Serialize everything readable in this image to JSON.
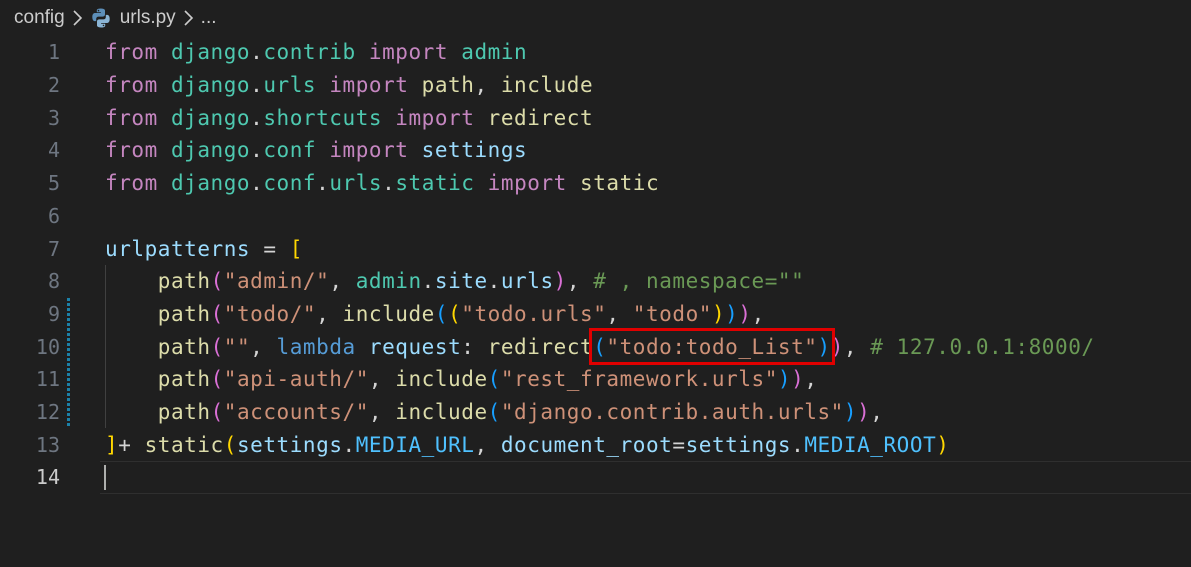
{
  "breadcrumb": {
    "folder": "config",
    "file": "urls.py",
    "more": "..."
  },
  "editor": {
    "current_line": 14,
    "lines": [
      {
        "n": "1",
        "t": [
          [
            "from ",
            "kw"
          ],
          [
            "django",
            "mod"
          ],
          [
            ".",
            "pl"
          ],
          [
            "contrib",
            "mod"
          ],
          [
            " import ",
            "kw"
          ],
          [
            "admin",
            "mod"
          ]
        ]
      },
      {
        "n": "2",
        "t": [
          [
            "from ",
            "kw"
          ],
          [
            "django",
            "mod"
          ],
          [
            ".",
            "pl"
          ],
          [
            "urls",
            "mod"
          ],
          [
            " import ",
            "kw"
          ],
          [
            "path",
            "fn"
          ],
          [
            ", ",
            "pl"
          ],
          [
            "include",
            "fn"
          ]
        ]
      },
      {
        "n": "3",
        "t": [
          [
            "from ",
            "kw"
          ],
          [
            "django",
            "mod"
          ],
          [
            ".",
            "pl"
          ],
          [
            "shortcuts",
            "mod"
          ],
          [
            " import ",
            "kw"
          ],
          [
            "redirect",
            "fn"
          ]
        ]
      },
      {
        "n": "4",
        "t": [
          [
            "from ",
            "kw"
          ],
          [
            "django",
            "mod"
          ],
          [
            ".",
            "pl"
          ],
          [
            "conf",
            "mod"
          ],
          [
            " import ",
            "kw"
          ],
          [
            "settings",
            "var"
          ]
        ]
      },
      {
        "n": "5",
        "t": [
          [
            "from ",
            "kw"
          ],
          [
            "django",
            "mod"
          ],
          [
            ".",
            "pl"
          ],
          [
            "conf",
            "mod"
          ],
          [
            ".",
            "pl"
          ],
          [
            "urls",
            "mod"
          ],
          [
            ".",
            "pl"
          ],
          [
            "static",
            "mod"
          ],
          [
            " import ",
            "kw"
          ],
          [
            "static",
            "fn"
          ]
        ]
      },
      {
        "n": "6",
        "t": []
      },
      {
        "n": "7",
        "t": [
          [
            "urlpatterns",
            "var"
          ],
          [
            " = ",
            "pl"
          ],
          [
            "[",
            "b1"
          ]
        ]
      },
      {
        "n": "8",
        "t": [
          [
            "    ",
            "pl"
          ],
          [
            "path",
            "fn"
          ],
          [
            "(",
            "b2"
          ],
          [
            "\"admin/\"",
            "str"
          ],
          [
            ", ",
            "pl"
          ],
          [
            "admin",
            "mod"
          ],
          [
            ".",
            "pl"
          ],
          [
            "site",
            "var"
          ],
          [
            ".",
            "pl"
          ],
          [
            "urls",
            "var"
          ],
          [
            ")",
            "b2"
          ],
          [
            ", ",
            "pl"
          ],
          [
            "# , namespace=\"\"",
            "cm"
          ]
        ]
      },
      {
        "n": "9",
        "t": [
          [
            "    ",
            "pl"
          ],
          [
            "path",
            "fn"
          ],
          [
            "(",
            "b2"
          ],
          [
            "\"todo/\"",
            "str"
          ],
          [
            ", ",
            "pl"
          ],
          [
            "include",
            "fn"
          ],
          [
            "(",
            "b3"
          ],
          [
            "(",
            "b1"
          ],
          [
            "\"todo.urls\"",
            "str"
          ],
          [
            ", ",
            "pl"
          ],
          [
            "\"todo\"",
            "str"
          ],
          [
            ")",
            "b1"
          ],
          [
            ")",
            "b3"
          ],
          [
            ")",
            "b2"
          ],
          [
            ",",
            "pl"
          ]
        ]
      },
      {
        "n": "10",
        "t": [
          [
            "    ",
            "pl"
          ],
          [
            "path",
            "fn"
          ],
          [
            "(",
            "b2"
          ],
          [
            "\"\"",
            "str"
          ],
          [
            ", ",
            "pl"
          ],
          [
            "lambda",
            "bl"
          ],
          [
            " request",
            "var"
          ],
          [
            ": ",
            "pl"
          ],
          [
            "redirect",
            "fn"
          ],
          [
            "(",
            "b3"
          ],
          [
            "\"todo:todo_List\"",
            "str"
          ],
          [
            ")",
            "b3"
          ],
          [
            ")",
            "b2"
          ],
          [
            ", ",
            "pl"
          ],
          [
            "# 127.0.0.1:8000/",
            "cm"
          ]
        ]
      },
      {
        "n": "11",
        "t": [
          [
            "    ",
            "pl"
          ],
          [
            "path",
            "fn"
          ],
          [
            "(",
            "b2"
          ],
          [
            "\"api-auth/\"",
            "str"
          ],
          [
            ", ",
            "pl"
          ],
          [
            "include",
            "fn"
          ],
          [
            "(",
            "b3"
          ],
          [
            "\"rest_framework.urls\"",
            "str"
          ],
          [
            ")",
            "b3"
          ],
          [
            ")",
            "b2"
          ],
          [
            ",",
            "pl"
          ]
        ]
      },
      {
        "n": "12",
        "t": [
          [
            "    ",
            "pl"
          ],
          [
            "path",
            "fn"
          ],
          [
            "(",
            "b2"
          ],
          [
            "\"accounts/\"",
            "str"
          ],
          [
            ", ",
            "pl"
          ],
          [
            "include",
            "fn"
          ],
          [
            "(",
            "b3"
          ],
          [
            "\"django.contrib.auth.urls\"",
            "str"
          ],
          [
            ")",
            "b3"
          ],
          [
            ")",
            "b2"
          ],
          [
            ",",
            "pl"
          ]
        ]
      },
      {
        "n": "13",
        "t": [
          [
            "]",
            "b1"
          ],
          [
            "+ ",
            "pl"
          ],
          [
            "static",
            "fn"
          ],
          [
            "(",
            "b1"
          ],
          [
            "settings",
            "var"
          ],
          [
            ".",
            "pl"
          ],
          [
            "MEDIA_URL",
            "cn"
          ],
          [
            ", ",
            "pl"
          ],
          [
            "document_root",
            "var"
          ],
          [
            "=",
            "pl"
          ],
          [
            "settings",
            "var"
          ],
          [
            ".",
            "pl"
          ],
          [
            "MEDIA_ROOT",
            "cn"
          ],
          [
            ")",
            "b1"
          ]
        ]
      },
      {
        "n": "14",
        "t": []
      }
    ]
  },
  "highlight": {
    "line": 10,
    "text": "(\"todo:todo_List\")",
    "color": "#e00000"
  },
  "colors": {
    "background": "#1f1f1f",
    "keyword": "#c586c0",
    "module": "#4ec9b0",
    "function": "#dcdcaa",
    "string": "#ce9178",
    "comment": "#6a9955",
    "variable": "#9cdcfe"
  }
}
